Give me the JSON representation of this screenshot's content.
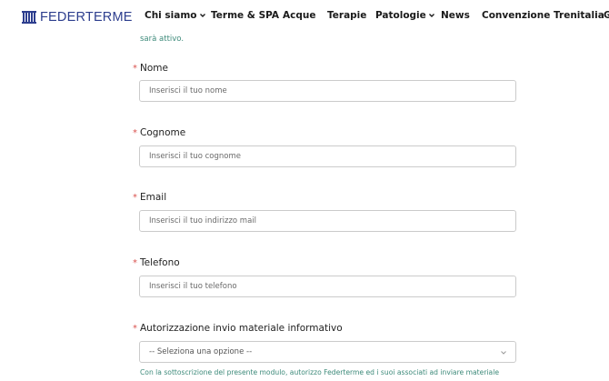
{
  "brand": {
    "name": "FEDERTERME"
  },
  "nav": {
    "items": [
      {
        "label": "Chi siamo",
        "has_dropdown": true
      },
      {
        "label": "Terme & SPA",
        "has_dropdown": false
      },
      {
        "label": "Acque",
        "has_dropdown": false
      },
      {
        "label": "Terapie",
        "has_dropdown": false
      },
      {
        "label": "Patologie",
        "has_dropdown": true
      },
      {
        "label": "News",
        "has_dropdown": false
      },
      {
        "label": "Convenzione Trenitalia",
        "has_dropdown": true
      },
      {
        "label": "C",
        "has_dropdown": false
      }
    ]
  },
  "form": {
    "top_note": "sarà attivo.",
    "required_marker": "*",
    "fields": [
      {
        "label": "Nome",
        "placeholder": "Inserisci il tuo nome"
      },
      {
        "label": "Cognome",
        "placeholder": "Inserisci il tuo cognome"
      },
      {
        "label": "Email",
        "placeholder": "Inserisci il tuo indirizzo mail"
      },
      {
        "label": "Telefono",
        "placeholder": "Inserisci il tuo telefono"
      }
    ],
    "consent": {
      "label": "Autorizzazione invio materiale informativo",
      "selected": "-- Seleziona una opzione --"
    },
    "bottom_note": "Con la sottoscrizione del presente modulo, autorizzo Federterme ed i suoi associati ad inviare materiale"
  },
  "colors": {
    "brand_blue": "#2d3e8e",
    "required_red": "#d9534f",
    "note_teal": "#3d8a7a",
    "border": "#cbcbcb"
  }
}
